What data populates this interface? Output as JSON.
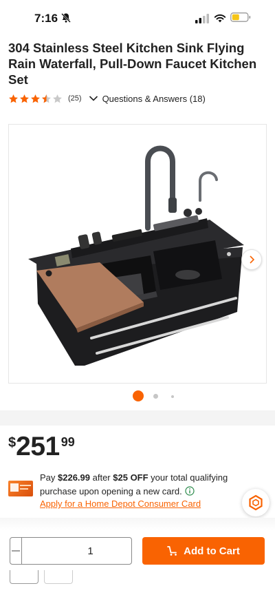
{
  "status_bar": {
    "time": "7:16",
    "icons": [
      "bell-off-icon",
      "signal-icon",
      "wifi-icon",
      "battery-icon"
    ],
    "battery_color": "#f5c518"
  },
  "product": {
    "title": "304 Stainless Steel Kitchen Sink Flying Rain Waterfall, Pull-Down Faucet Kitchen Set",
    "rating_stars": 3.5,
    "review_count": "(25)",
    "qa_label": "Questions & Answers (18)",
    "image_alt": "Black stainless steel kitchen sink with pull-down faucet and wooden cutting board",
    "image_count": 3,
    "active_image_index": 0
  },
  "price": {
    "currency": "$",
    "whole": "251",
    "cents": "99"
  },
  "promo": {
    "pay_prefix": "Pay ",
    "pay_amount": "$226.99",
    "after_text": " after ",
    "discount": "$25 OFF",
    "rest_text": " your total qualifying purchase upon opening a new card.",
    "apply_link": "Apply for a Home Depot Consumer Card"
  },
  "cart": {
    "quantity": "1",
    "add_to_cart_label": "Add to Cart"
  },
  "colors": {
    "accent": "#f96302",
    "star": "#f96302",
    "star_empty": "#c9c9c9"
  }
}
